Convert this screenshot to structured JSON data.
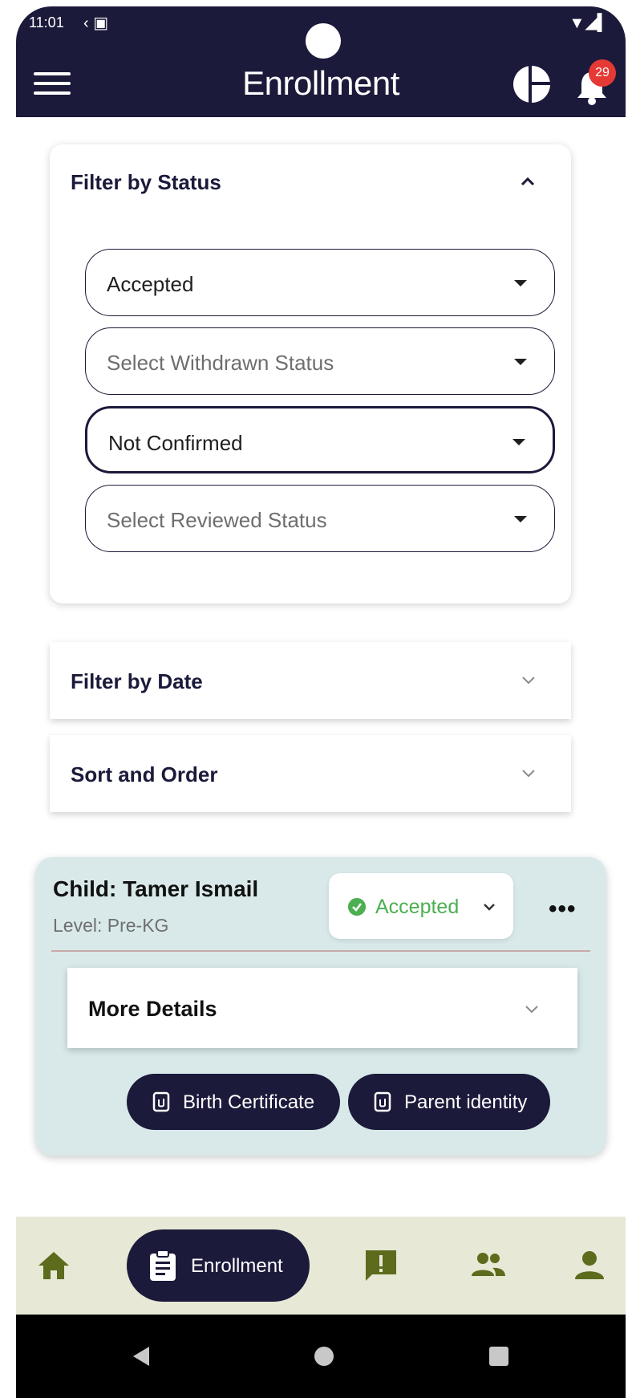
{
  "status_bar": {
    "time": "11:01",
    "left_icons": "‹ ▣",
    "right_icons": "▼◢▍"
  },
  "app_bar": {
    "title": "Enrollment",
    "notification_count": "29"
  },
  "filter_status": {
    "title": "Filter by Status",
    "expanded": true,
    "selects": [
      {
        "value": "Accepted",
        "is_placeholder": false
      },
      {
        "value": "Select Withdrawn Status",
        "is_placeholder": true
      },
      {
        "value": "Not Confirmed",
        "is_placeholder": false,
        "focused": true
      },
      {
        "value": "Select Reviewed Status",
        "is_placeholder": true
      }
    ]
  },
  "filter_date": {
    "title": "Filter by Date"
  },
  "sort_order": {
    "title": "Sort and Order"
  },
  "child_card": {
    "name": "Child: Tamer Ismail",
    "level": "Level: Pre-KG",
    "status": "Accepted",
    "more_details": "More Details",
    "documents": [
      "Birth Certificate",
      "Parent identity"
    ]
  },
  "bottom_nav": {
    "active_label": "Enrollment",
    "items": [
      "home-icon",
      "enrollment-icon",
      "feedback-icon",
      "people-icon",
      "person-icon"
    ]
  },
  "colors": {
    "primary": "#1b1a3a",
    "card_bg": "#d9e9ea",
    "nav_bg": "#e7e8d6",
    "nav_icon": "#5c6b1c",
    "accepted": "#4caf50",
    "badge": "#e53935"
  }
}
